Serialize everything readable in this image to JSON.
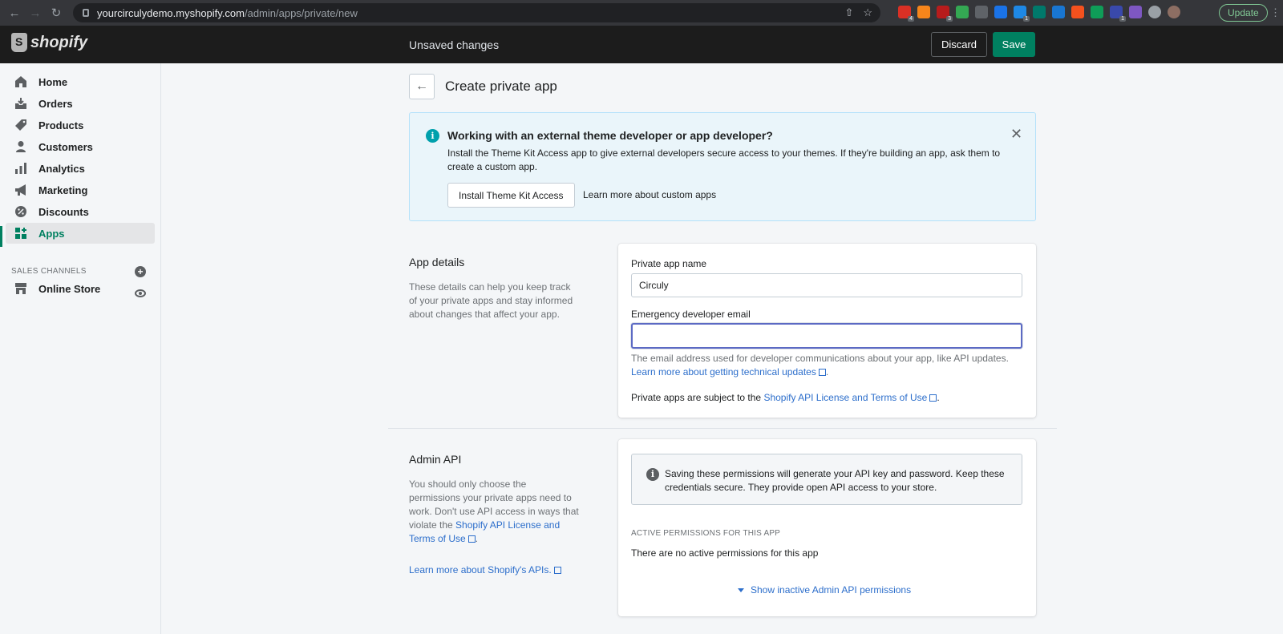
{
  "browser": {
    "url_host": "yourcirculydemo.myshopify.com",
    "url_path": "/admin/apps/private/new",
    "update_label": "Update",
    "extensions": [
      {
        "name": "ext-red-icon",
        "color": "#d93025",
        "badge": "4"
      },
      {
        "name": "ext-metamask-icon",
        "color": "#f6851b",
        "badge": ""
      },
      {
        "name": "ext-dark-red-icon",
        "color": "#b71c1c",
        "badge": "3"
      },
      {
        "name": "ext-green-icon",
        "color": "#34a853",
        "badge": ""
      },
      {
        "name": "ext-recycle-icon",
        "color": "#5f6368",
        "badge": ""
      },
      {
        "name": "ext-blue-icon",
        "color": "#1a73e8",
        "badge": ""
      },
      {
        "name": "ext-navy-icon",
        "color": "#1e88e5",
        "badge": "1"
      },
      {
        "name": "ext-teal-icon",
        "color": "#00796b",
        "badge": ""
      },
      {
        "name": "ext-sky-icon",
        "color": "#1976d2",
        "badge": ""
      },
      {
        "name": "ext-orange-icon",
        "color": "#f4511e",
        "badge": ""
      },
      {
        "name": "ext-green2-icon",
        "color": "#0f9d58",
        "badge": ""
      },
      {
        "name": "ext-gear-icon",
        "color": "#3949ab",
        "badge": "1"
      },
      {
        "name": "ext-purple-icon",
        "color": "#7e57c2",
        "badge": ""
      },
      {
        "name": "puzzle-icon",
        "color": "#9aa0a6",
        "badge": ""
      },
      {
        "name": "profile-avatar",
        "color": "#8d6e63",
        "badge": ""
      }
    ]
  },
  "topbar": {
    "logo_text": "shopify",
    "status": "Unsaved changes",
    "discard_label": "Discard",
    "save_label": "Save"
  },
  "sidebar": {
    "items": [
      {
        "label": "Home",
        "icon": "home-icon"
      },
      {
        "label": "Orders",
        "icon": "orders-icon"
      },
      {
        "label": "Products",
        "icon": "tag-icon"
      },
      {
        "label": "Customers",
        "icon": "person-icon"
      },
      {
        "label": "Analytics",
        "icon": "bar-chart-icon"
      },
      {
        "label": "Marketing",
        "icon": "megaphone-icon"
      },
      {
        "label": "Discounts",
        "icon": "discount-icon"
      },
      {
        "label": "Apps",
        "icon": "apps-icon"
      }
    ],
    "channels_heading": "SALES CHANNELS",
    "online_store": "Online Store"
  },
  "page": {
    "title": "Create private app",
    "banner": {
      "title": "Working with an external theme developer or app developer?",
      "body": "Install the Theme Kit Access app to give external developers secure access to your themes. If they're building an app, ask them to create a custom app.",
      "install_label": "Install Theme Kit Access",
      "learn_label": "Learn more about custom apps"
    },
    "app_details": {
      "title": "App details",
      "description": "These details can help you keep track of your private apps and stay informed about changes that affect your app.",
      "name_label": "Private app name",
      "name_value": "Circuly",
      "email_label": "Emergency developer email",
      "email_value": "",
      "email_help": "The email address used for developer communications about your app, like API updates.",
      "email_help_link": "Learn more about getting technical updates",
      "terms_prefix": "Private apps are subject to the ",
      "terms_link": "Shopify API License and Terms of Use",
      "terms_suffix": "."
    },
    "admin_api": {
      "title": "Admin API",
      "description": "You should only choose the permissions your private apps need to work. Don't use API access in ways that violate the ",
      "description_link": "Shopify API License and Terms of Use",
      "description_suffix": ".",
      "learn_apis": "Learn more about Shopify's APIs.",
      "notice": "Saving these permissions will generate your API key and password. Keep these credentials secure. They provide open API access to your store.",
      "active_heading": "ACTIVE PERMISSIONS FOR THIS APP",
      "no_active": "There are no active permissions for this app",
      "show_inactive": "Show inactive Admin API permissions"
    }
  }
}
